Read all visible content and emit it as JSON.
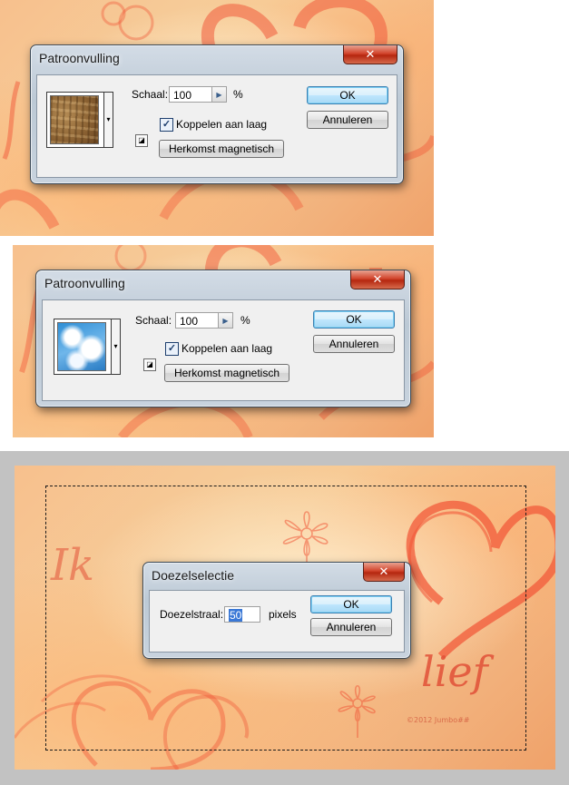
{
  "colors": {
    "accent_red": "#f15a3a",
    "ok_blue": "#a7d9f5",
    "frame_grey": "#bfbfbf"
  },
  "panel1": {
    "dialog": {
      "title": "Patroonvulling",
      "close_glyph": "✕",
      "scale_label": "Schaal:",
      "scale_value": "100",
      "percent": "%",
      "link_label": "Koppelen aan laag",
      "link_checked": true,
      "snap_origin_label": "Herkomst magnetisch",
      "ok_label": "OK",
      "cancel_label": "Annuleren",
      "pattern": "wood-texture"
    }
  },
  "panel2": {
    "dialog": {
      "title": "Patroonvulling",
      "close_glyph": "✕",
      "scale_label": "Schaal:",
      "scale_value": "100",
      "percent": "%",
      "link_label": "Koppelen aan laag",
      "link_checked": true,
      "snap_origin_label": "Herkomst magnetisch",
      "ok_label": "OK",
      "cancel_label": "Annuleren",
      "pattern": "sky-clouds"
    }
  },
  "panel3": {
    "canvas_text": {
      "word1": "Ik",
      "word2": "lief",
      "copyright": "©2012 Jumbo##"
    },
    "dialog": {
      "title": "Doezelselectie",
      "close_glyph": "✕",
      "radius_label": "Doezelstraal:",
      "radius_value": "50",
      "unit": "pixels",
      "ok_label": "OK",
      "cancel_label": "Annuleren"
    }
  }
}
